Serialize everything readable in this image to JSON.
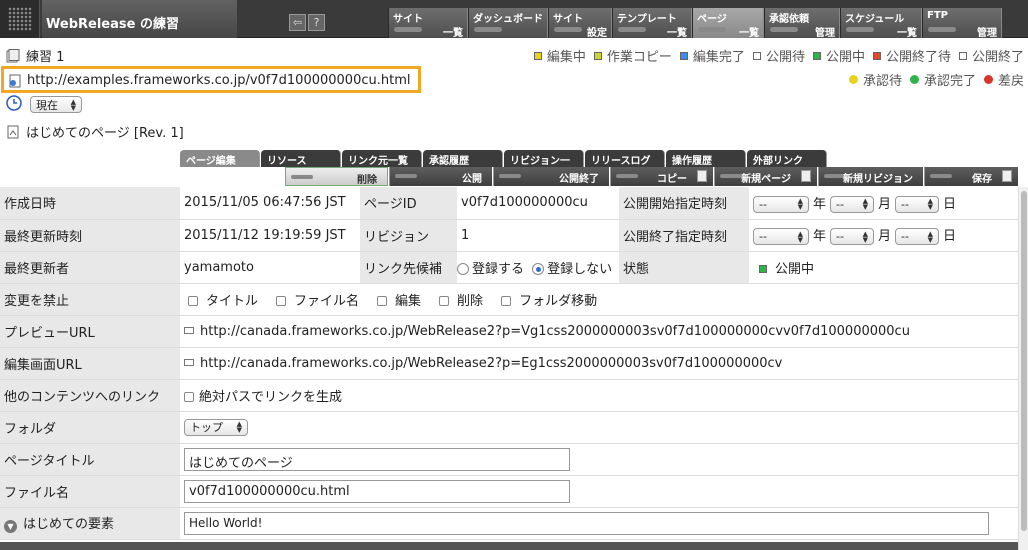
{
  "app": {
    "title": "WebRelease の練習"
  },
  "topnav": [
    {
      "a": "サイト",
      "b": "一覧"
    },
    {
      "a": "ダッシュボード",
      "b": ""
    },
    {
      "a": "サイト",
      "b": "設定"
    },
    {
      "a": "テンプレート",
      "b": "一覧"
    },
    {
      "a": "ページ",
      "b": "一覧"
    },
    {
      "a": "承認依頼",
      "b": "管理"
    },
    {
      "a": "スケジュール",
      "b": "一覧"
    },
    {
      "a": "FTP",
      "b": "管理"
    }
  ],
  "header": {
    "site_name": "練習 1",
    "url": "http://examples.frameworks.co.jp/v0f7d100000000cu.html",
    "revision_select": "現在",
    "page_title_rev": "はじめてのページ [Rev. 1]"
  },
  "legend1": [
    {
      "label": "編集中",
      "color": "#e8d21a",
      "shape": "sq"
    },
    {
      "label": "作業コピー",
      "color": "#c7d92a",
      "shape": "sq"
    },
    {
      "label": "編集完了",
      "color": "#3a8dde",
      "shape": "sq"
    },
    {
      "label": "公開待",
      "color": "#ffffff",
      "shape": "sq"
    },
    {
      "label": "公開中",
      "color": "#2fb44a",
      "shape": "sq"
    },
    {
      "label": "公開終了待",
      "color": "#e24a22",
      "shape": "sq"
    },
    {
      "label": "公開終了",
      "color": "#ffffff",
      "shape": "sq"
    }
  ],
  "legend2": [
    {
      "label": "承認待",
      "color": "#e8d21a"
    },
    {
      "label": "承認完了",
      "color": "#2fb44a"
    },
    {
      "label": "差戻",
      "color": "#d9352b"
    }
  ],
  "tabs": [
    "ページ編集",
    "リソース",
    "リンク元一覧",
    "承認履歴",
    "リビジョン一覧",
    "リリースログ",
    "操作履歴",
    "外部リンク"
  ],
  "actions": [
    "削除",
    "公開",
    "公開終了",
    "コピー",
    "新規ページ",
    "新規リビジョン",
    "保存"
  ],
  "form": {
    "created_label": "作成日時",
    "created_value": "2015/11/05 06:47:56 JST",
    "pageid_label": "ページID",
    "pageid_value": "v0f7d100000000cu",
    "pub_start_label": "公開開始指定時刻",
    "updated_label": "最終更新時刻",
    "updated_value": "2015/11/12 19:19:59 JST",
    "revision_label": "リビジョン",
    "revision_value": "1",
    "pub_end_label": "公開終了指定時刻",
    "updater_label": "最終更新者",
    "updater_value": "yamamoto",
    "link_cand_label": "リンク先候補",
    "register_yes": "登録する",
    "register_no": "登録しない",
    "state_label": "状態",
    "state_value": "公開中",
    "lock_label": "変更を禁止",
    "lock_options": [
      "タイトル",
      "ファイル名",
      "編集",
      "削除",
      "フォルダ移動"
    ],
    "preview_label": "プレビューURL",
    "preview_url": "http://canada.frameworks.co.jp/WebRelease2?p=Vg1css2000000003sv0f7d100000000cvv0f7d100000000cu",
    "edit_label": "編集画面URL",
    "edit_url": "http://canada.frameworks.co.jp/WebRelease2?p=Eg1css2000000003sv0f7d100000000cv",
    "link_label": "他のコンテンツへのリンク",
    "abs_path": "絶対パスでリンクを生成",
    "folder_label": "フォルダ",
    "folder_value": "トップ",
    "title_label": "ページタイトル",
    "title_value": "はじめてのページ",
    "file_label": "ファイル名",
    "file_value": "v0f7d100000000cu.html",
    "element_label": "はじめての要素",
    "element_value": "Hello World!"
  },
  "date_units": {
    "year": "年",
    "month": "月",
    "day": "日",
    "blank": "--"
  }
}
